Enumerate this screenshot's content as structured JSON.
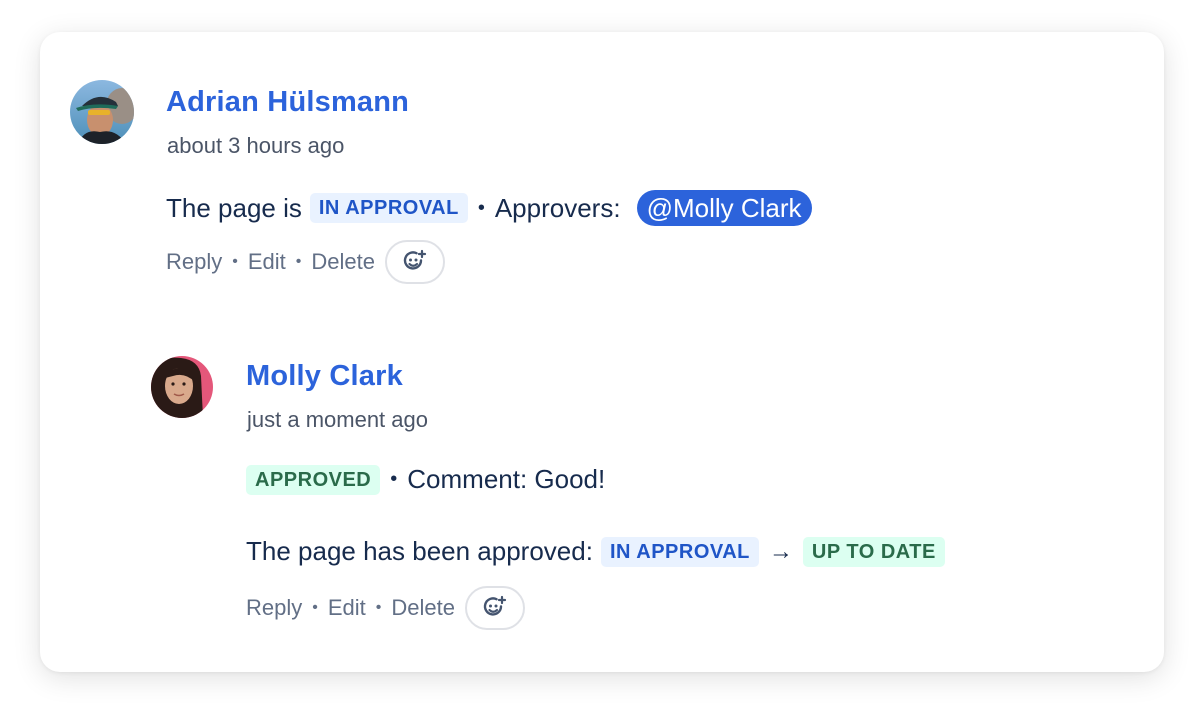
{
  "comments": [
    {
      "author": "Adrian Hülsmann",
      "time": "about 3 hours ago",
      "body": {
        "prefix": "The page is",
        "status": "IN APPROVAL",
        "approvers_label": "Approvers:",
        "mention": "@Molly Clark"
      },
      "actions": {
        "reply": "Reply",
        "edit": "Edit",
        "delete": "Delete",
        "separator": "•"
      }
    },
    {
      "author": "Molly Clark",
      "time": "just a moment ago",
      "body": {
        "status": "APPROVED",
        "comment": "Comment: Good!",
        "approved_prefix": "The page has been approved:",
        "from_status": "IN APPROVAL",
        "arrow": "→",
        "to_status": "UP TO DATE"
      },
      "actions": {
        "reply": "Reply",
        "edit": "Edit",
        "delete": "Delete",
        "separator": "•"
      }
    }
  ],
  "colors": {
    "author": "#2c63db",
    "mention_bg": "#2c63db",
    "lozenge_blue_bg": "#e9f2ff",
    "lozenge_blue_text": "#1f55c7",
    "lozenge_green_bg": "#dcfff1",
    "lozenge_green_text": "#2a6b4a"
  },
  "icons": {
    "add_reaction": "emoji-add-icon"
  }
}
